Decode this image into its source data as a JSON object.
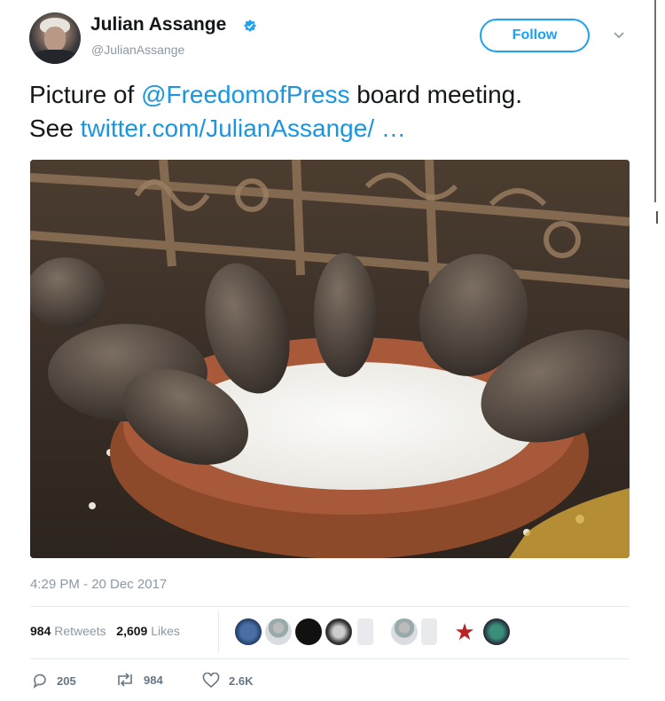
{
  "tweet": {
    "author_name": "Julian Assange",
    "author_handle": "@JulianAssange",
    "verified": true,
    "follow_label": "Follow",
    "text_prefix": "Picture of ",
    "mention": "@FreedomofPress",
    "text_suffix": " board meeting.",
    "text_see": "See ",
    "link_text": "twitter.com/JulianAssange/ …",
    "timestamp": "4:29 PM - 20 Dec 2017",
    "retweets_count": "984",
    "retweets_label": "Retweets",
    "likes_count": "2,609",
    "likes_label": "Likes",
    "reply_count": "205",
    "retweet_action_count": "984",
    "like_action_count": "2.6K"
  },
  "liker_avatars": [
    "avatar-1",
    "avatar-2",
    "avatar-3",
    "avatar-4",
    "avatar-5",
    "avatar-6",
    "avatar-7",
    "avatar-8",
    "avatar-9"
  ],
  "icons": {
    "verified": "verified-badge-icon",
    "chevron": "chevron-down-icon",
    "reply": "reply-icon",
    "retweet": "retweet-icon",
    "like": "heart-icon"
  },
  "colors": {
    "accent": "#1da1f2",
    "link": "#1b95e0",
    "muted": "#8b98a5",
    "text": "#14171a"
  }
}
